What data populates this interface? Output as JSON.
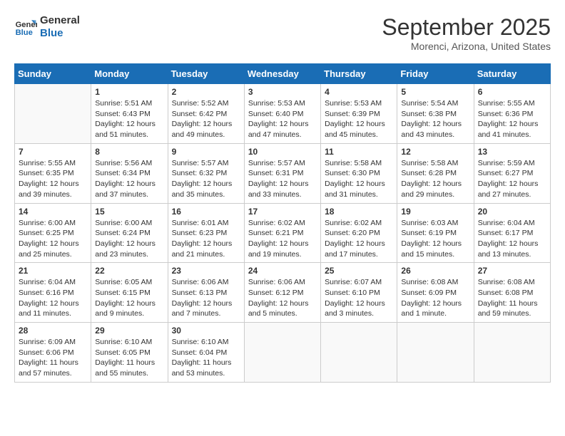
{
  "header": {
    "logo_line1": "General",
    "logo_line2": "Blue",
    "month": "September 2025",
    "location": "Morenci, Arizona, United States"
  },
  "days_header": [
    "Sunday",
    "Monday",
    "Tuesday",
    "Wednesday",
    "Thursday",
    "Friday",
    "Saturday"
  ],
  "weeks": [
    [
      {
        "num": "",
        "info": ""
      },
      {
        "num": "1",
        "info": "Sunrise: 5:51 AM\nSunset: 6:43 PM\nDaylight: 12 hours\nand 51 minutes."
      },
      {
        "num": "2",
        "info": "Sunrise: 5:52 AM\nSunset: 6:42 PM\nDaylight: 12 hours\nand 49 minutes."
      },
      {
        "num": "3",
        "info": "Sunrise: 5:53 AM\nSunset: 6:40 PM\nDaylight: 12 hours\nand 47 minutes."
      },
      {
        "num": "4",
        "info": "Sunrise: 5:53 AM\nSunset: 6:39 PM\nDaylight: 12 hours\nand 45 minutes."
      },
      {
        "num": "5",
        "info": "Sunrise: 5:54 AM\nSunset: 6:38 PM\nDaylight: 12 hours\nand 43 minutes."
      },
      {
        "num": "6",
        "info": "Sunrise: 5:55 AM\nSunset: 6:36 PM\nDaylight: 12 hours\nand 41 minutes."
      }
    ],
    [
      {
        "num": "7",
        "info": "Sunrise: 5:55 AM\nSunset: 6:35 PM\nDaylight: 12 hours\nand 39 minutes."
      },
      {
        "num": "8",
        "info": "Sunrise: 5:56 AM\nSunset: 6:34 PM\nDaylight: 12 hours\nand 37 minutes."
      },
      {
        "num": "9",
        "info": "Sunrise: 5:57 AM\nSunset: 6:32 PM\nDaylight: 12 hours\nand 35 minutes."
      },
      {
        "num": "10",
        "info": "Sunrise: 5:57 AM\nSunset: 6:31 PM\nDaylight: 12 hours\nand 33 minutes."
      },
      {
        "num": "11",
        "info": "Sunrise: 5:58 AM\nSunset: 6:30 PM\nDaylight: 12 hours\nand 31 minutes."
      },
      {
        "num": "12",
        "info": "Sunrise: 5:58 AM\nSunset: 6:28 PM\nDaylight: 12 hours\nand 29 minutes."
      },
      {
        "num": "13",
        "info": "Sunrise: 5:59 AM\nSunset: 6:27 PM\nDaylight: 12 hours\nand 27 minutes."
      }
    ],
    [
      {
        "num": "14",
        "info": "Sunrise: 6:00 AM\nSunset: 6:25 PM\nDaylight: 12 hours\nand 25 minutes."
      },
      {
        "num": "15",
        "info": "Sunrise: 6:00 AM\nSunset: 6:24 PM\nDaylight: 12 hours\nand 23 minutes."
      },
      {
        "num": "16",
        "info": "Sunrise: 6:01 AM\nSunset: 6:23 PM\nDaylight: 12 hours\nand 21 minutes."
      },
      {
        "num": "17",
        "info": "Sunrise: 6:02 AM\nSunset: 6:21 PM\nDaylight: 12 hours\nand 19 minutes."
      },
      {
        "num": "18",
        "info": "Sunrise: 6:02 AM\nSunset: 6:20 PM\nDaylight: 12 hours\nand 17 minutes."
      },
      {
        "num": "19",
        "info": "Sunrise: 6:03 AM\nSunset: 6:19 PM\nDaylight: 12 hours\nand 15 minutes."
      },
      {
        "num": "20",
        "info": "Sunrise: 6:04 AM\nSunset: 6:17 PM\nDaylight: 12 hours\nand 13 minutes."
      }
    ],
    [
      {
        "num": "21",
        "info": "Sunrise: 6:04 AM\nSunset: 6:16 PM\nDaylight: 12 hours\nand 11 minutes."
      },
      {
        "num": "22",
        "info": "Sunrise: 6:05 AM\nSunset: 6:15 PM\nDaylight: 12 hours\nand 9 minutes."
      },
      {
        "num": "23",
        "info": "Sunrise: 6:06 AM\nSunset: 6:13 PM\nDaylight: 12 hours\nand 7 minutes."
      },
      {
        "num": "24",
        "info": "Sunrise: 6:06 AM\nSunset: 6:12 PM\nDaylight: 12 hours\nand 5 minutes."
      },
      {
        "num": "25",
        "info": "Sunrise: 6:07 AM\nSunset: 6:10 PM\nDaylight: 12 hours\nand 3 minutes."
      },
      {
        "num": "26",
        "info": "Sunrise: 6:08 AM\nSunset: 6:09 PM\nDaylight: 12 hours\nand 1 minute."
      },
      {
        "num": "27",
        "info": "Sunrise: 6:08 AM\nSunset: 6:08 PM\nDaylight: 11 hours\nand 59 minutes."
      }
    ],
    [
      {
        "num": "28",
        "info": "Sunrise: 6:09 AM\nSunset: 6:06 PM\nDaylight: 11 hours\nand 57 minutes."
      },
      {
        "num": "29",
        "info": "Sunrise: 6:10 AM\nSunset: 6:05 PM\nDaylight: 11 hours\nand 55 minutes."
      },
      {
        "num": "30",
        "info": "Sunrise: 6:10 AM\nSunset: 6:04 PM\nDaylight: 11 hours\nand 53 minutes."
      },
      {
        "num": "",
        "info": ""
      },
      {
        "num": "",
        "info": ""
      },
      {
        "num": "",
        "info": ""
      },
      {
        "num": "",
        "info": ""
      }
    ]
  ]
}
